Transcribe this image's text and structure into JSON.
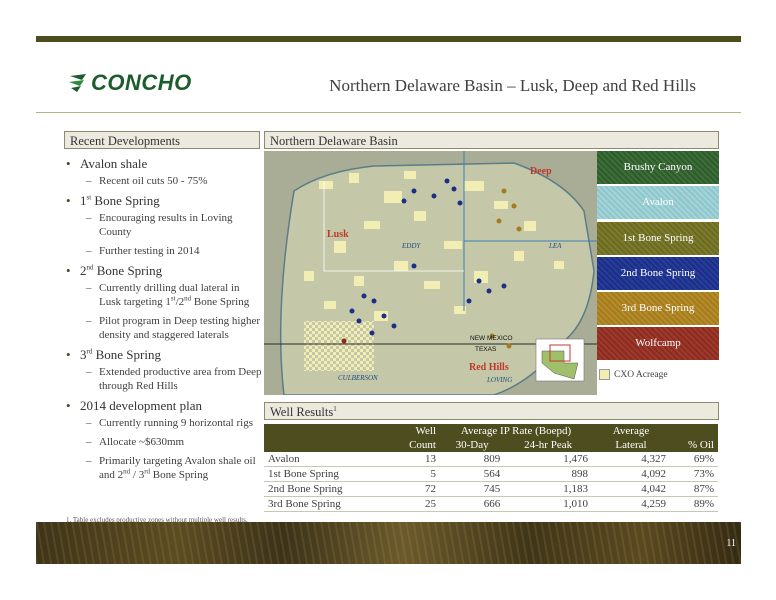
{
  "header": {
    "title": "Northern Delaware Basin – Lusk, Deep and Red Hills",
    "logo_text": "CONCHO"
  },
  "left": {
    "heading": "Recent Developments",
    "items": [
      {
        "label": "Avalon shale",
        "subs": [
          {
            "text": "Recent oil cuts 50 - 75%"
          }
        ]
      },
      {
        "label_pre": "1",
        "label_sup": "st",
        "label_post": " Bone Spring",
        "subs": [
          {
            "text": "Encouraging results in Loving County"
          },
          {
            "text": "Further testing in 2014"
          }
        ]
      },
      {
        "label_pre": "2",
        "label_sup": "nd",
        "label_post": " Bone Spring",
        "subs": [
          {
            "a": "Currently drilling dual lateral in Lusk targeting 1",
            "s1": "st",
            "b": "/2",
            "s2": "nd",
            "c": " Bone Spring"
          },
          {
            "text": "Pilot program in Deep testing higher density and staggered laterals"
          }
        ]
      },
      {
        "label_pre": "3",
        "label_sup": "rd",
        "label_post": " Bone Spring",
        "subs": [
          {
            "text": "Extended productive area from Deep through Red Hills"
          }
        ]
      },
      {
        "label": "2014 development plan",
        "subs": [
          {
            "text": "Currently running 9 horizontal rigs"
          },
          {
            "text": "Allocate ~$630mm"
          },
          {
            "a": "Primarily targeting Avalon shale oil and 2",
            "s1": "nd",
            "b": " / 3",
            "s2": "rd",
            "c": " Bone Spring"
          }
        ]
      }
    ]
  },
  "map": {
    "heading": "Northern Delaware Basin",
    "labels": {
      "deep": "Deep",
      "lusk": "Lusk",
      "redhills": "Red Hills",
      "eddy": "EDDY",
      "lea": "LEA",
      "culberson": "CULBERSON",
      "loving": "LOVING",
      "nm": "NEW MEXICO",
      "tx": "TEXAS"
    },
    "legend": [
      {
        "label": "Brushy Canyon",
        "color": "#2e5a2c"
      },
      {
        "label": "Avalon",
        "color": "#8fc6cc"
      },
      {
        "label": "1st Bone Spring",
        "color": "#6b6a22"
      },
      {
        "label": "2nd Bone Spring",
        "color": "#1c2f86"
      },
      {
        "label": "3rd Bone Spring",
        "color": "#a47c1e"
      },
      {
        "label": "Wolfcamp",
        "color": "#8c2b1f"
      }
    ],
    "cxo_label": "CXO Acreage",
    "cxo_color": "#f1edb3"
  },
  "results": {
    "heading": "Well Results",
    "heading_sup": "1",
    "col_well": "Well",
    "col_count": "Count",
    "col_avg_ip": "Average IP Rate (Boepd)",
    "col_30day": "30-Day",
    "col_24hr": "24-hr Peak",
    "col_avg": "Average",
    "col_lateral": "Lateral",
    "col_oil": "% Oil",
    "rows": [
      {
        "name": "Avalon",
        "count": "13",
        "d30": "809",
        "peak": "1,476",
        "lateral": "4,327",
        "oil": "69%"
      },
      {
        "name": "1st Bone Spring",
        "count": "5",
        "d30": "564",
        "peak": "898",
        "lateral": "4,092",
        "oil": "73%"
      },
      {
        "name": "2nd Bone Spring",
        "count": "72",
        "d30": "745",
        "peak": "1,183",
        "lateral": "4,042",
        "oil": "87%"
      },
      {
        "name": "3rd Bone Spring",
        "count": "25",
        "d30": "666",
        "peak": "1,010",
        "lateral": "4,259",
        "oil": "89%"
      }
    ]
  },
  "footnote": "1.    Table excludes productive zones without multiple well results.",
  "page_number": "11"
}
